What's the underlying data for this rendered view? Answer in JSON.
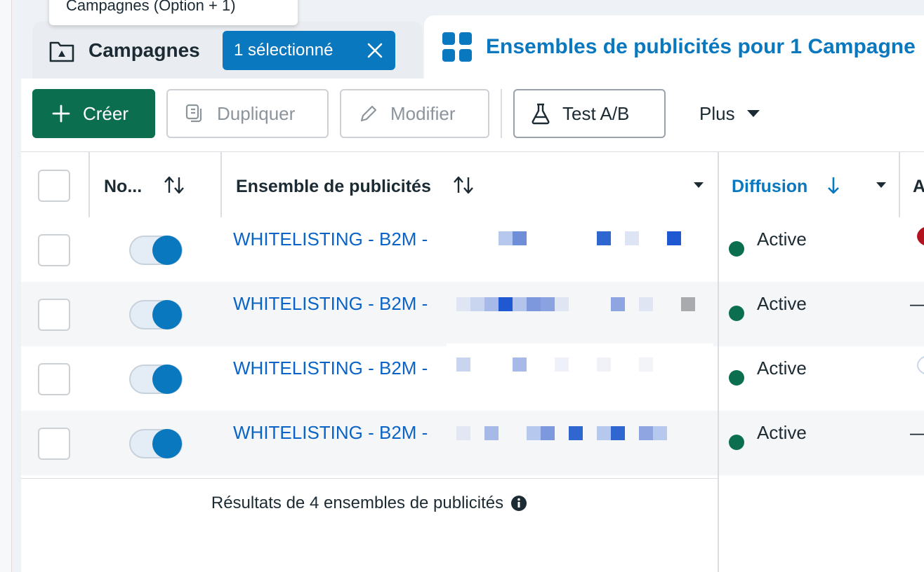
{
  "tooltip": {
    "text": "Campagnes (Option + 1)"
  },
  "tabs": {
    "campaigns": {
      "title": "Campagnes",
      "chip_label": "1 sélectionné"
    },
    "adsets": {
      "title": "Ensembles de publicités pour 1 Campagne"
    }
  },
  "toolbar": {
    "create_label": "Créer",
    "duplicate_label": "Dupliquer",
    "edit_label": "Modifier",
    "ab_test_label": "Test A/B",
    "more_label": "Plus"
  },
  "table": {
    "columns": {
      "name_short": "No...",
      "adset": "Ensemble de publicités",
      "delivery": "Diffusion",
      "next_partial": "A"
    },
    "rows": [
      {
        "name": "WHITELISTING - B2M -",
        "status": "Active"
      },
      {
        "name": "WHITELISTING - B2M -",
        "status": "Active"
      },
      {
        "name": "WHITELISTING - B2M -",
        "status": "Active"
      },
      {
        "name": "WHITELISTING - B2M -",
        "status": "Active"
      }
    ],
    "row_edge_marks": [
      "",
      "—",
      "",
      "—"
    ],
    "results_label": "Résultats de 4 ensembles de publicités"
  },
  "colors": {
    "accent_blue": "#0a78be",
    "link_blue": "#0a64c8",
    "create_green": "#0b6e4f",
    "active_green": "#0b6e4f"
  },
  "icons": {
    "campaign_tab": "folder-icon",
    "chip_close": "close-icon",
    "adsets_tab": "grid-icon",
    "create": "plus-icon",
    "duplicate": "duplicate-icon",
    "edit": "pencil-icon",
    "ab_test": "flask-icon",
    "more": "caret-down-icon",
    "sort": "sort-icon",
    "info": "info-icon"
  }
}
